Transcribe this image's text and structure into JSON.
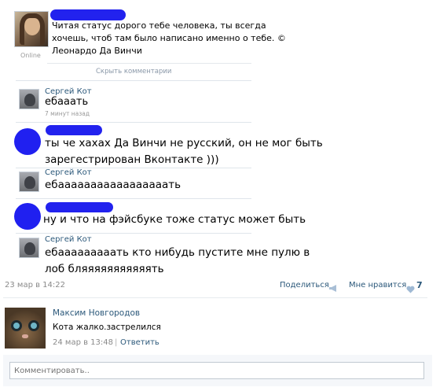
{
  "status_post": {
    "online_label": "Online",
    "text": "Читая статус дорого тебе человека, ты всегда хочешь, чтоб там было написано именно о тебе. © Леонардо Да Винчи",
    "hide_comments": "Скрыть комментарии"
  },
  "comments": [
    {
      "author": "Сергей Кот",
      "text": "ебааать",
      "time": "7 минут назад"
    },
    {
      "text": "ты че хахах Да Винчи не русский, он не мог быть зарегестрирован Вконтакте )))"
    },
    {
      "author": "Сергей Кот",
      "text": "ебааааааааааааааааать"
    },
    {
      "text": "ну и что на фэйсбуке тоже статус может быть"
    },
    {
      "author": "Сергей Кот",
      "text": "ебааааааааать кто нибудь пустите мне пулю в лоб бляяяяяяяяяяять"
    }
  ],
  "footer": {
    "date": "23 мар в 14:22",
    "share_label": "Поделиться",
    "like_label": "Мне нравится",
    "like_count": "7"
  },
  "reply": {
    "author": "Максим Новгородов",
    "text": "Кота жалко.застрелился",
    "date": "24 мар в 13:48",
    "separator": "|",
    "answer_label": "Ответить"
  },
  "comment_box": {
    "placeholder": "Комментировать.."
  },
  "colors": {
    "link": "#2b587a",
    "redaction": "#2222ee",
    "heart": "#9fb9d4"
  }
}
